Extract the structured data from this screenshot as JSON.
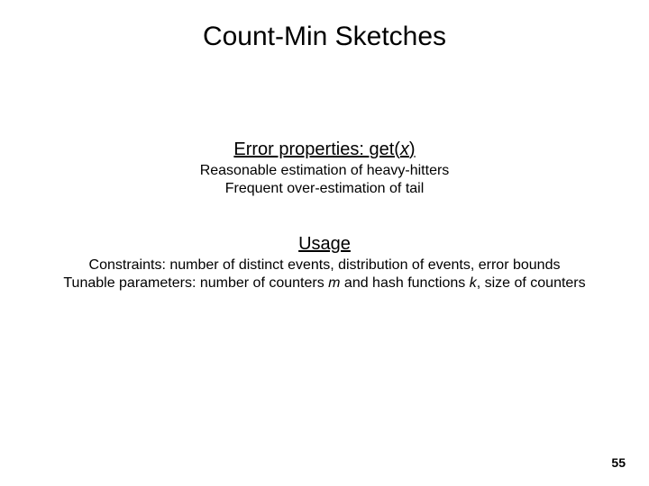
{
  "title": "Count-Min Sketches",
  "section1": {
    "heading_prefix": "Error properties: ",
    "heading_fn": "get(",
    "heading_arg": "x",
    "heading_suffix": ")",
    "line1": "Reasonable estimation of heavy-hitters",
    "line2": "Frequent over-estimation of tail"
  },
  "section2": {
    "heading": "Usage",
    "constraints_label": "Constraints: ",
    "constraints_text": "number of distinct events, distribution of events, error bounds",
    "tunable_label": "Tunable parameters: ",
    "tunable_pre": "number of counters ",
    "tunable_m": "m",
    "tunable_mid": " and hash functions ",
    "tunable_k": "k",
    "tunable_post": ", size of counters"
  },
  "page_number": "55"
}
